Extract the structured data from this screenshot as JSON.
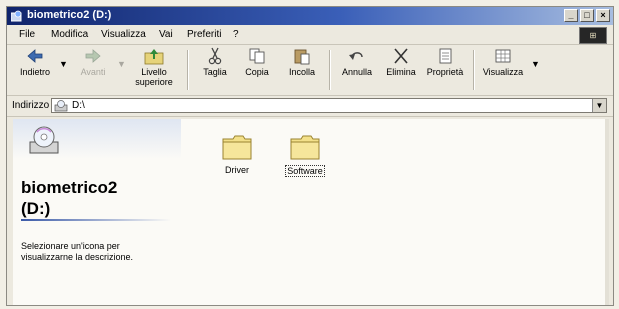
{
  "window": {
    "title": "biometrico2 (D:)"
  },
  "menu": {
    "items": [
      "File",
      "Modifica",
      "Visualizza",
      "Vai",
      "Preferiti",
      "?"
    ]
  },
  "toolbar": {
    "back": "Indietro",
    "forward": "Avanti",
    "up_line1": "Livello",
    "up_line2": "superiore",
    "cut": "Taglia",
    "copy": "Copia",
    "paste": "Incolla",
    "undo": "Annulla",
    "delete": "Elimina",
    "properties": "Proprietà",
    "view": "Visualizza"
  },
  "address": {
    "label": "Indirizzo",
    "value": "D:\\"
  },
  "left_pane": {
    "title_line1": "biometrico2",
    "title_line2": "(D:)",
    "description": "Selezionare un'icona per visualizzarne la descrizione."
  },
  "folders": [
    {
      "name": "Driver",
      "selected": false
    },
    {
      "name": "Software",
      "selected": true
    }
  ],
  "colors": {
    "titlebar_start": "#10246b",
    "folder": "#f3e08a"
  },
  "icons": {
    "window": "explorer-icon",
    "back": "back-arrow-icon",
    "forward": "forward-arrow-icon",
    "up": "up-folder-icon",
    "cut": "scissors-icon",
    "copy": "copy-icon",
    "paste": "paste-icon",
    "undo": "undo-icon",
    "delete": "delete-x-icon",
    "properties": "properties-icon",
    "view": "views-icon",
    "drive": "cd-drive-icon",
    "folder": "folder-icon"
  }
}
